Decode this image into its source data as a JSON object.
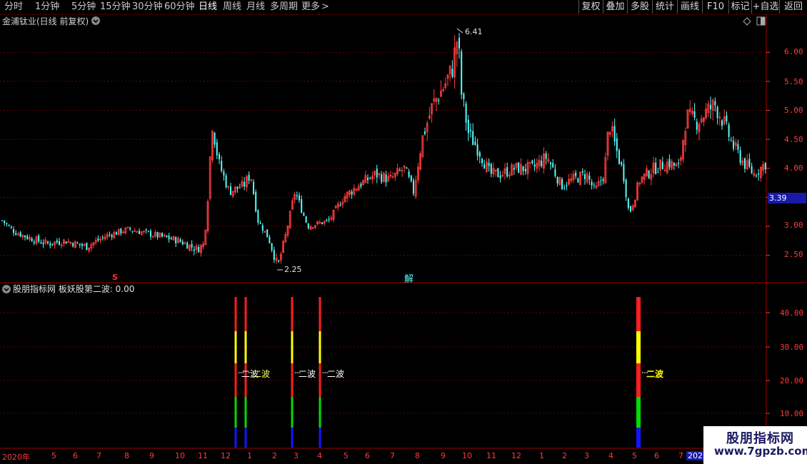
{
  "toolbar": {
    "periods": [
      "分时",
      "1分钟",
      "5分钟",
      "15分钟",
      "30分钟",
      "60分钟",
      "日线",
      "周线",
      "月线",
      "多周期",
      "更多"
    ],
    "active_period": "日线",
    "more_arrow": ">",
    "buttons": [
      "复权",
      "叠加",
      "多股",
      "统计",
      "画线",
      "F10",
      "标记",
      "+自选",
      "返回"
    ]
  },
  "main_panel": {
    "title": "金浦钛业(日线 前复权)",
    "high_label": "6.41",
    "low_label": "2.25",
    "current_price": "3.39",
    "marker_s": "S",
    "marker_jie": "解",
    "y_ticks": [
      "6.00",
      "5.50",
      "5.00",
      "4.50",
      "4.00",
      "3.00",
      "2.50"
    ]
  },
  "indicator_panel": {
    "title": "股朋指标网 板妖股第二波: 0.00",
    "y_ticks": [
      "40.00",
      "30.00",
      "20.00",
      "10.00"
    ],
    "signal_texts": [
      "二波",
      "二波",
      "二波",
      "二波",
      "二波"
    ]
  },
  "x_axis": {
    "labels": [
      "2020年",
      "5",
      "6",
      "7",
      "8",
      "9",
      "10",
      "11",
      "12",
      "1",
      "2",
      "3",
      "4",
      "5",
      "6",
      "7",
      "8",
      "9",
      "10",
      "11",
      "12",
      "1",
      "2",
      "3",
      "4",
      "5",
      "6",
      "7",
      "202"
    ]
  },
  "watermark": {
    "line1": "股朋指标网",
    "line2": "www.7gpzb.com"
  },
  "colors": {
    "up": "#ff3b3b",
    "down": "#54ffff",
    "grid": "#6a0000",
    "signal_red": "#ff1e1e",
    "signal_yellow": "#ffff00",
    "signal_green": "#00dd00",
    "signal_blue": "#1414ff"
  }
}
